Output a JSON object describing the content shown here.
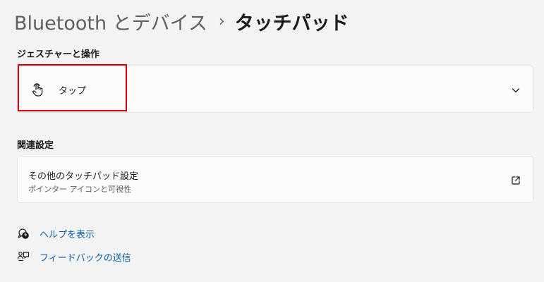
{
  "breadcrumb": {
    "parent": "Bluetooth とデバイス",
    "separator": "›",
    "current": "タッチパッド"
  },
  "gestures_section": {
    "title": "ジェスチャーと操作",
    "tap_card": {
      "label": "タップ",
      "icon": "touch-hand-icon",
      "expand_icon": "chevron-down-icon"
    }
  },
  "related_section": {
    "title": "関連設定",
    "more_touchpad_card": {
      "label": "その他のタッチパッド設定",
      "sublabel": "ポインター アイコンと可視性",
      "icon": "open-external-icon"
    }
  },
  "footer_links": [
    {
      "label": "ヘルプを表示",
      "icon": "help-icon"
    },
    {
      "label": "フィードバックの送信",
      "icon": "feedback-icon"
    }
  ],
  "colors": {
    "background": "#f3f3f3",
    "card": "#fbfbfb",
    "link": "#0a5fa8",
    "highlight": "#e10000"
  }
}
